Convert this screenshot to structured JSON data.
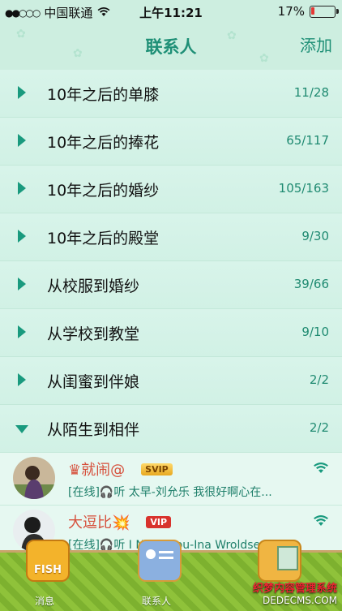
{
  "status": {
    "carrier": "中国联通",
    "time": "上午11:21",
    "battery": "17%",
    "battery_level": 0.17
  },
  "nav": {
    "title": "联系人",
    "add": "添加"
  },
  "groups": [
    {
      "name": "10年之后的单膝",
      "count": "11/28"
    },
    {
      "name": "10年之后的捧花",
      "count": "65/117"
    },
    {
      "name": "10年之后的婚纱",
      "count": "105/163"
    },
    {
      "name": "10年之后的殿堂",
      "count": "9/30"
    },
    {
      "name": "从校服到婚纱",
      "count": "39/66"
    },
    {
      "name": "从学校到教堂",
      "count": "9/10"
    },
    {
      "name": "从闺蜜到伴娘",
      "count": "2/2"
    },
    {
      "name": "从陌生到相伴",
      "count": "2/2"
    }
  ],
  "friends": [
    {
      "name": "♛就闹@",
      "badge": "SVIP",
      "status": "[在线]🎧听 太早-刘允乐 我很好啊心在..."
    },
    {
      "name": "大逗比💥",
      "badge": "VIP",
      "status": "[在线]🎧听 I Need you-Ina Wroldsen..."
    }
  ],
  "tabs": [
    {
      "label": "消息",
      "icon": "fish-box-icon",
      "icon_text": "FISH"
    },
    {
      "label": "联系人",
      "icon": "contact-card-icon"
    },
    {
      "label": "",
      "icon": "cat-picture-icon"
    }
  ],
  "watermark": {
    "line1": "织梦内容管理系统",
    "line2": "DEDECMS.COM"
  }
}
